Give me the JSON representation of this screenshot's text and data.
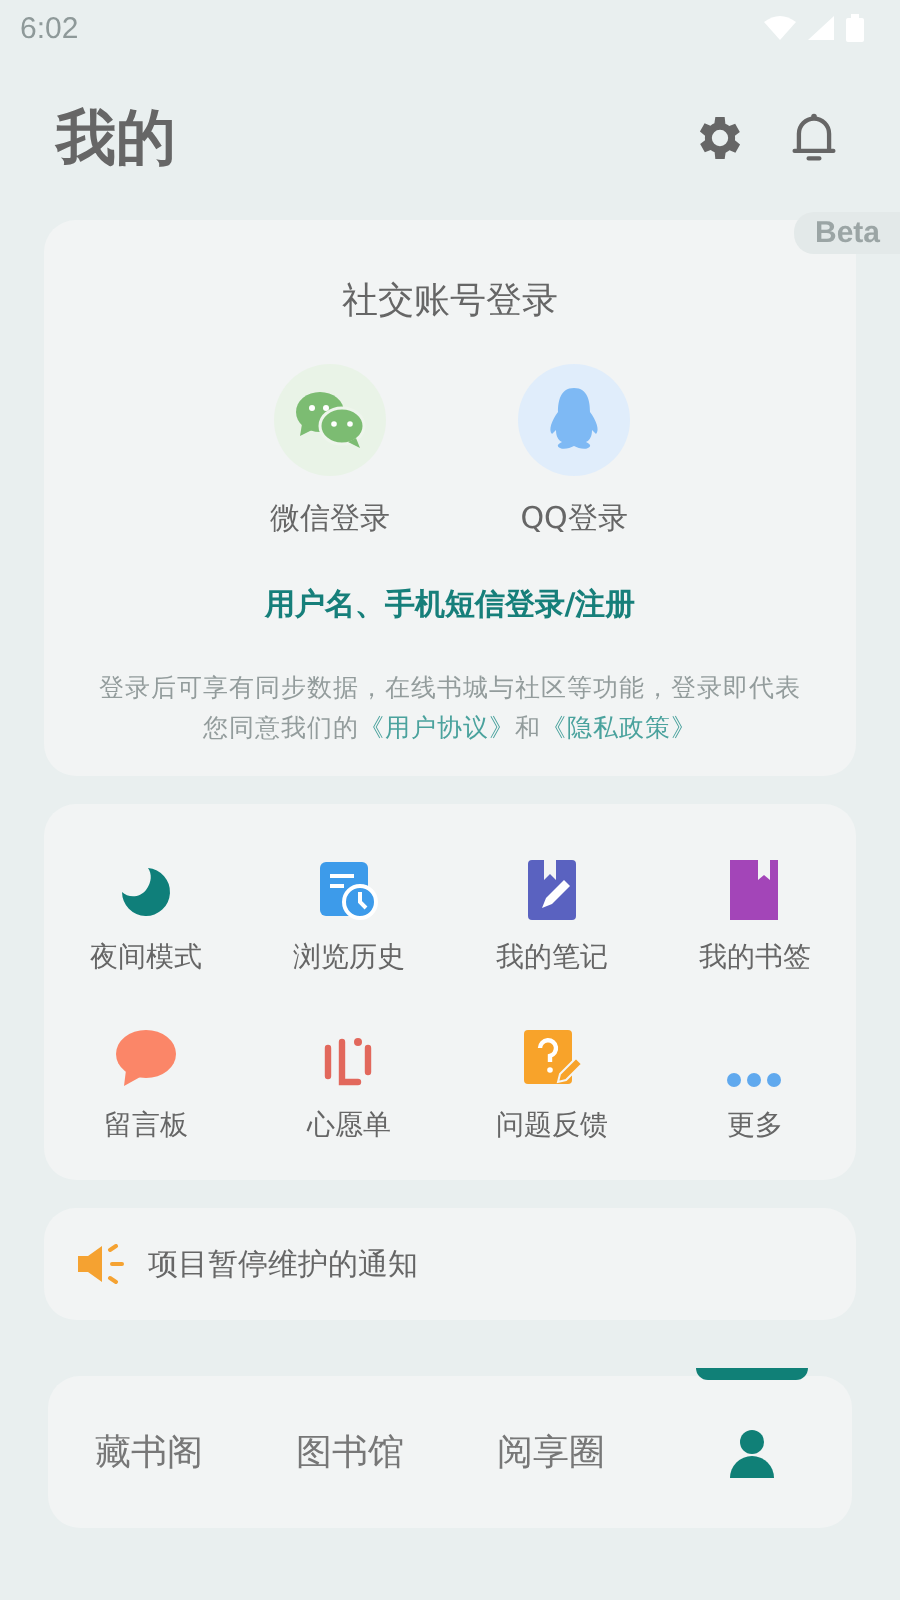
{
  "status_bar": {
    "time": "6:02"
  },
  "header": {
    "title": "我的"
  },
  "beta_badge": "Beta",
  "login": {
    "title": "社交账号登录",
    "options": [
      {
        "kind": "wechat",
        "label": "微信登录"
      },
      {
        "kind": "qq",
        "label": "QQ登录"
      }
    ],
    "account_link": "用户名、手机短信登录/注册",
    "notice": "登录后可享有同步数据，在线书城与社区等功能，登录即代表您同意我们的",
    "agreement_link": "《用户协议》",
    "conjunction": "和",
    "privacy_link": "《隐私政策》"
  },
  "shortcuts": [
    {
      "kind": "moon",
      "label": "夜间模式",
      "color": "#0f7f7a"
    },
    {
      "kind": "history",
      "label": "浏览历史",
      "color": "#3d9bea"
    },
    {
      "kind": "notes",
      "label": "我的笔记",
      "color": "#5a62c0"
    },
    {
      "kind": "bookmark",
      "label": "我的书签",
      "color": "#a345b8"
    },
    {
      "kind": "message",
      "label": "留言板",
      "color": "#fb8668"
    },
    {
      "kind": "wish",
      "label": "心愿单",
      "color": "#e2685c"
    },
    {
      "kind": "feedback",
      "label": "问题反馈",
      "color": "#f8a32a"
    },
    {
      "kind": "more",
      "label": "更多",
      "color": "#60a9ee"
    }
  ],
  "announcement": "项目暂停维护的通知",
  "bottom_nav": [
    {
      "kind": "text",
      "label": "藏书阁",
      "selected": false
    },
    {
      "kind": "text",
      "label": "图书馆",
      "selected": false
    },
    {
      "kind": "text",
      "label": "阅享圈",
      "selected": false
    },
    {
      "kind": "icon",
      "selected": true
    }
  ]
}
